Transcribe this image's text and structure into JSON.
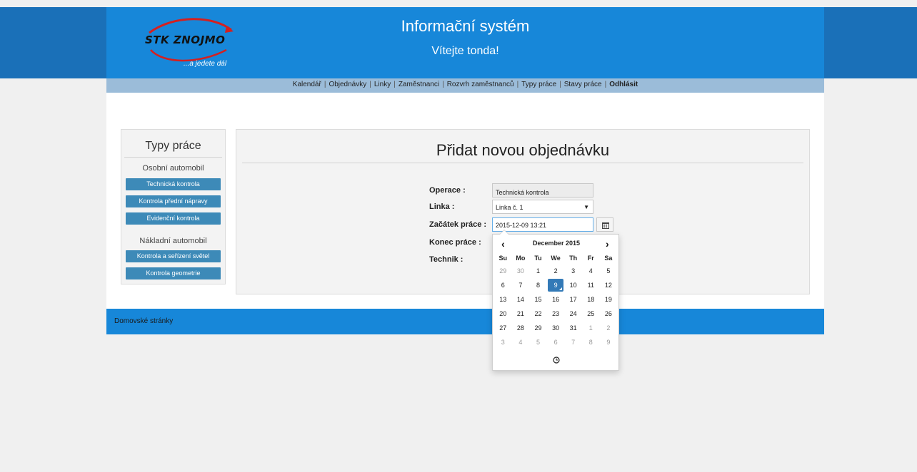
{
  "header": {
    "logo_brand": "STK ZNOJMO",
    "logo_tagline": "...a jedete dál",
    "title": "Informační systém",
    "welcome": "Vítejte tonda!"
  },
  "nav": {
    "items": [
      "Kalendář",
      "Objednávky",
      "Linky",
      "Zaměstnanci",
      "Rozvrh zaměstnanců",
      "Typy práce",
      "Stavy práce"
    ],
    "logout": "Odhlásit",
    "separator": "|"
  },
  "sidebar": {
    "title": "Typy práce",
    "group_car": "Osobní automobil",
    "car_buttons": [
      "Technická kontrola",
      "Kontrola přední nápravy",
      "Evidenční kontrola"
    ],
    "group_truck": "Nákladní automobil",
    "truck_buttons": [
      "Kontrola a seřízení světel",
      "Kontrola geometrie"
    ]
  },
  "form": {
    "title": "Přidat novou objednávku",
    "operation_label": "Operace :",
    "operation_value": "Technická kontrola",
    "line_label": "Linka :",
    "line_value": "Linka č. 1",
    "start_label": "Začátek práce :",
    "start_value": "2015-12-09 13:21",
    "end_label": "Konec práce :",
    "technician_label": "Technik :"
  },
  "datepicker": {
    "month": "December 2015",
    "prev": "‹",
    "next": "›",
    "weekdays": [
      "Su",
      "Mo",
      "Tu",
      "We",
      "Th",
      "Fr",
      "Sa"
    ],
    "weeks": [
      [
        "29",
        "30",
        "1",
        "2",
        "3",
        "4",
        "5"
      ],
      [
        "6",
        "7",
        "8",
        "9",
        "10",
        "11",
        "12"
      ],
      [
        "13",
        "14",
        "15",
        "16",
        "17",
        "18",
        "19"
      ],
      [
        "20",
        "21",
        "22",
        "23",
        "24",
        "25",
        "26"
      ],
      [
        "27",
        "28",
        "29",
        "30",
        "31",
        "1",
        "2"
      ],
      [
        "3",
        "4",
        "5",
        "6",
        "7",
        "8",
        "9"
      ]
    ],
    "selected_day": "9"
  },
  "footer": {
    "link": "Domovské stránky"
  },
  "colors": {
    "header_blue": "#1787d9",
    "nav_band": "#9bbcd9",
    "button_blue": "#3d8ab8",
    "selected_day": "#337ab7"
  }
}
